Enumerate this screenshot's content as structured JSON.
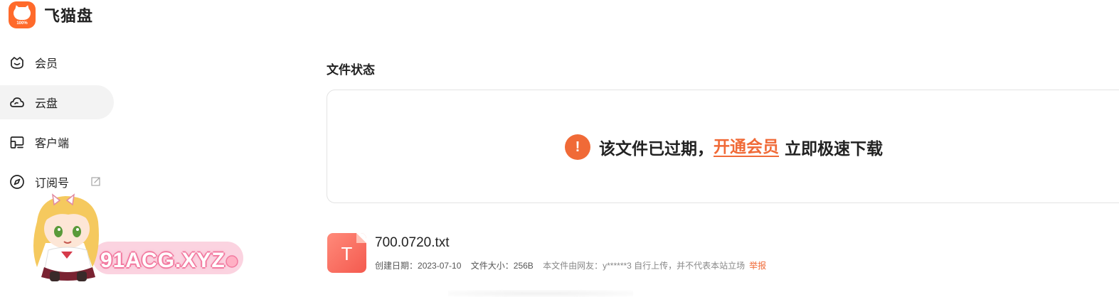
{
  "brand": {
    "name": "飞猫盘",
    "logo_tag": "100%"
  },
  "sidebar": {
    "items": [
      {
        "label": "会员",
        "icon": "crown-icon"
      },
      {
        "label": "云盘",
        "icon": "cloud-icon",
        "active": true
      },
      {
        "label": "客户端",
        "icon": "devices-icon"
      },
      {
        "label": "订阅号",
        "icon": "compass-icon",
        "external": true
      }
    ]
  },
  "watermark": {
    "text": "91ACG.XYZ"
  },
  "status": {
    "title": "文件状态",
    "message": "该文件已过期，",
    "link_label": "开通会员",
    "message_tail": "立即极速下载"
  },
  "file": {
    "icon_letter": "T",
    "name": "700.0720.txt",
    "created_label": "创建日期：",
    "created_value": "2023-07-10",
    "size_label": "文件大小：",
    "size_value": "256B",
    "uploader_note": "本文件由网友：y******3 自行上传，并不代表本站立场",
    "report_label": "举报"
  },
  "colors": {
    "accent": "#f06a37",
    "brand": "#ff6a2b",
    "active_bg": "#f3f3f3"
  }
}
